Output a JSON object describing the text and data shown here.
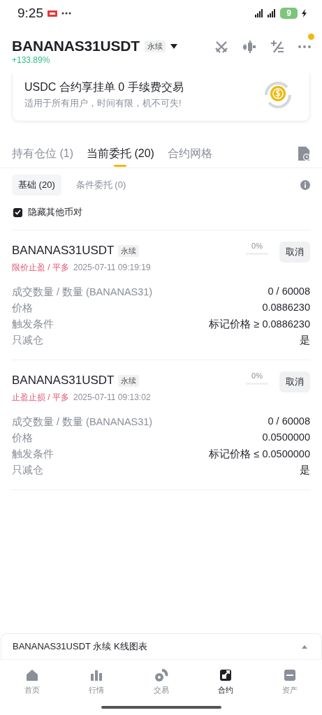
{
  "status_bar": {
    "time": "9:25",
    "battery": "9"
  },
  "header": {
    "symbol": "BANANAS31USDT",
    "tag": "永续",
    "change": "+133.89%",
    "notification_dot": true
  },
  "promo": {
    "title": "USDC 合约享挂单 0 手续费交易",
    "subtitle": "适用于所有用户，时间有限，机不可失!"
  },
  "tabs": [
    {
      "label": "持有仓位 (1)",
      "selected": false
    },
    {
      "label": "当前委托 (20)",
      "selected": true
    },
    {
      "label": "合约网格",
      "selected": false
    }
  ],
  "filters": [
    {
      "label": "基础 (20)",
      "selected": true
    },
    {
      "label": "条件委托 (0)",
      "selected": false
    }
  ],
  "hide_other_pairs": {
    "label": "隐藏其他币对",
    "checked": true
  },
  "orders": [
    {
      "symbol": "BANANAS31USDT",
      "tag": "永续",
      "type": "限价止盈 / 平多",
      "time": "2025-07-11 09:19:19",
      "progress": "0%",
      "cancel": "取消",
      "details": [
        {
          "label": "成交数量 / 数量 (BANANAS31)",
          "value": "0 / 60008"
        },
        {
          "label": "价格",
          "value": "0.0886230"
        },
        {
          "label": "触发条件",
          "value": "标记价格 ≥ 0.0886230"
        },
        {
          "label": "只减仓",
          "value": "是"
        }
      ]
    },
    {
      "symbol": "BANANAS31USDT",
      "tag": "永续",
      "type": "止盈止损 / 平多",
      "time": "2025-07-11 09:13:02",
      "progress": "0%",
      "cancel": "取消",
      "details": [
        {
          "label": "成交数量 / 数量 (BANANAS31)",
          "value": "0 / 60008"
        },
        {
          "label": "价格",
          "value": "0.0500000"
        },
        {
          "label": "触发条件",
          "value": "标记价格 ≤ 0.0500000"
        },
        {
          "label": "只减仓",
          "value": "是"
        }
      ]
    }
  ],
  "chart_bar": {
    "label": "BANANAS31USDT 永续 K线图表"
  },
  "nav": [
    {
      "label": "首页",
      "selected": false
    },
    {
      "label": "行情",
      "selected": false
    },
    {
      "label": "交易",
      "selected": false
    },
    {
      "label": "合约",
      "selected": true
    },
    {
      "label": "资产",
      "selected": false
    }
  ]
}
